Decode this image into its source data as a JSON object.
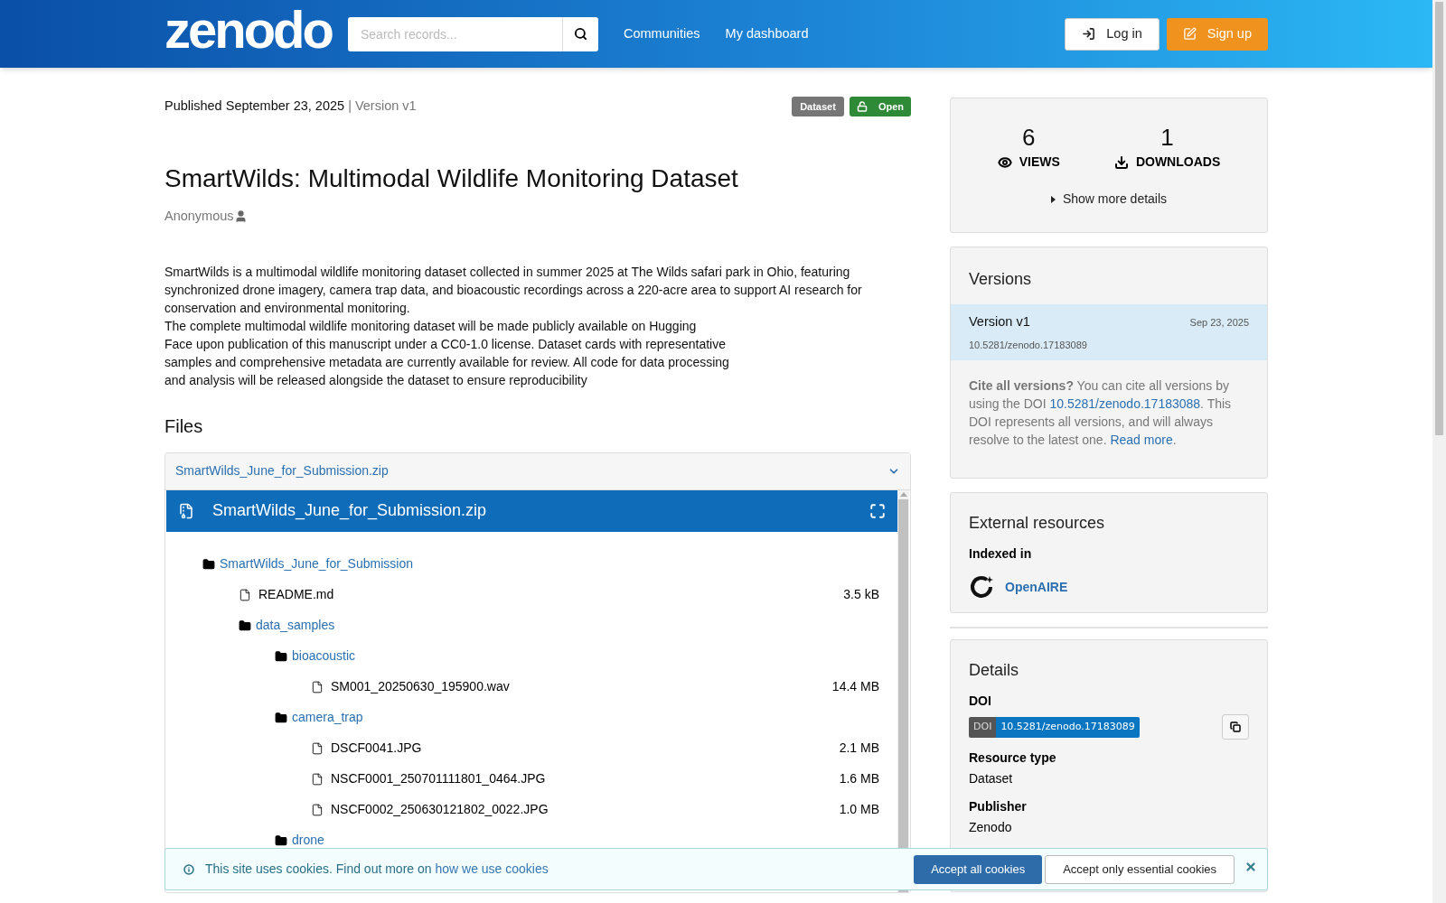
{
  "header": {
    "logo": "zenodo",
    "search": {
      "placeholder": "Search records..."
    },
    "nav": [
      "Communities",
      "My dashboard"
    ],
    "login": "Log in",
    "signup": "Sign up"
  },
  "record": {
    "published": "Published September 23, 2025",
    "version": "| Version v1",
    "badges": [
      {
        "kind": "type",
        "label": "Dataset"
      },
      {
        "kind": "access",
        "label": "Open"
      }
    ],
    "title": "SmartWilds: Multimodal Wildlife Monitoring Dataset",
    "creator": "Anonymous",
    "description": [
      "SmartWilds is a multimodal wildlife monitoring dataset collected in summer 2025 at The Wilds safari park in Ohio, featuring synchronized drone imagery, camera trap data, and bioacoustic recordings across a 220-acre area to support AI research for conservation and environmental monitoring.",
      "The complete multimodal wildlife monitoring dataset will be made publicly available on Hugging",
      "Face upon publication of this manuscript under a CC0-1.0 license. Dataset cards with representative",
      "samples and comprehensive metadata are currently available for review. All code for data processing",
      "and analysis will be released alongside the dataset to ensure reproducibility"
    ]
  },
  "files": {
    "heading": "Files",
    "accordion_title": "SmartWilds_June_for_Submission.zip",
    "preview_title": "SmartWilds_June_for_Submission.zip",
    "tree": [
      {
        "kind": "folder",
        "name": "SmartWilds_June_for_Submission",
        "children": [
          {
            "kind": "file",
            "name": "README.md",
            "size": "3.5 kB"
          },
          {
            "kind": "folder",
            "name": "data_samples",
            "children": [
              {
                "kind": "folder",
                "name": "bioacoustic",
                "children": [
                  {
                    "kind": "file",
                    "name": "SM001_20250630_195900.wav",
                    "size": "14.4 MB"
                  }
                ]
              },
              {
                "kind": "folder",
                "name": "camera_trap",
                "children": [
                  {
                    "kind": "file",
                    "name": "DSCF0041.JPG",
                    "size": "2.1 MB"
                  },
                  {
                    "kind": "file",
                    "name": "NSCF0001_250701111801_0464.JPG",
                    "size": "1.6 MB"
                  },
                  {
                    "kind": "file",
                    "name": "NSCF0002_250630121802_0022.JPG",
                    "size": "1.0 MB"
                  }
                ]
              },
              {
                "kind": "folder",
                "name": "drone"
              }
            ]
          }
        ]
      }
    ]
  },
  "stats": {
    "views": "6",
    "views_label": "VIEWS",
    "downloads": "1",
    "downloads_label": "DOWNLOADS",
    "more": "Show more details"
  },
  "versions": {
    "heading": "Versions",
    "items": [
      {
        "label": "Version v1",
        "date": "Sep 23, 2025",
        "doi": "10.5281/zenodo.17183089",
        "selected": true
      }
    ],
    "cite_bold": "Cite all versions?",
    "cite_text": "You can cite all versions by using the DOI",
    "cite_doi": "10.5281/zenodo.17183088",
    "cite_rest": ". This DOI represents all versions, and will always resolve to the latest one.",
    "read_more": "Read more",
    "period": "."
  },
  "external": {
    "heading": "External resources",
    "indexed": "Indexed in",
    "openaire": "OpenAIRE"
  },
  "details": {
    "heading": "Details",
    "doi_label": "DOI",
    "doi_badge_left": "DOI",
    "doi_badge_right": "10.5281/zenodo.17183089",
    "resource_type_label": "Resource type",
    "resource_type": "Dataset",
    "publisher_label": "Publisher",
    "publisher": "Zenodo"
  },
  "cookies": {
    "text": "This site uses cookies. Find out more on",
    "link": "how we use cookies",
    "accept_all": "Accept all cookies",
    "accept_essential": "Accept only essential cookies"
  }
}
